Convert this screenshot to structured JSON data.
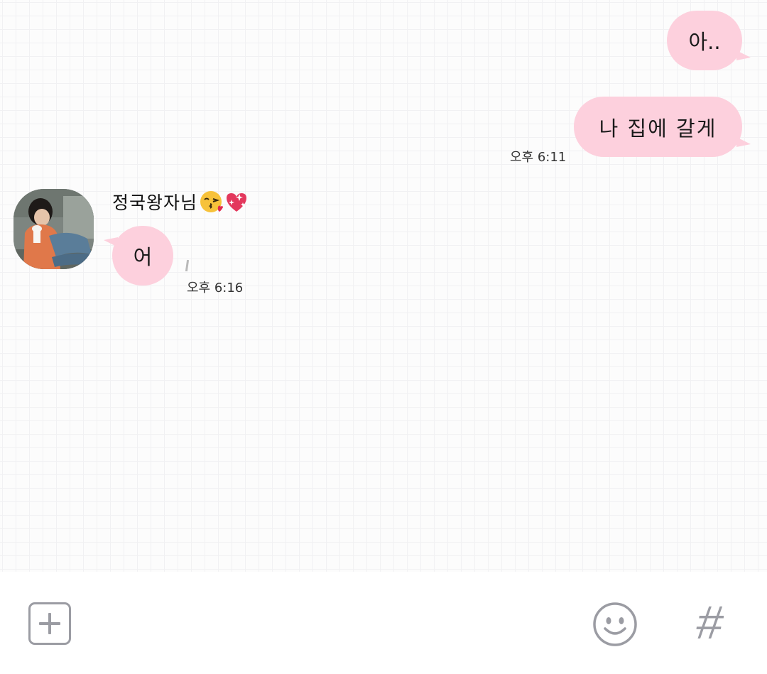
{
  "messages": [
    {
      "direction": "outgoing",
      "text": "아..",
      "time": ""
    },
    {
      "direction": "outgoing",
      "text": "나 집에 갈게",
      "time": "오후 6:11"
    },
    {
      "direction": "incoming",
      "sender": "정국왕자님",
      "text": "어",
      "time": "오후 6:16",
      "unread_mark": "1"
    }
  ],
  "sender": {
    "name": "정국왕자님",
    "emojis": [
      "kissing-face-emoji",
      "sparkling-heart-emoji"
    ],
    "avatar": "profile-photo-avatar"
  },
  "input_bar": {
    "plus_icon": "plus-icon",
    "emoji_icon": "emoticon-icon",
    "hash_label": "#"
  },
  "colors": {
    "bubble": "#fdd0dd",
    "grid_line": "#f1f1f3",
    "icon_gray": "#9b9ca3"
  }
}
